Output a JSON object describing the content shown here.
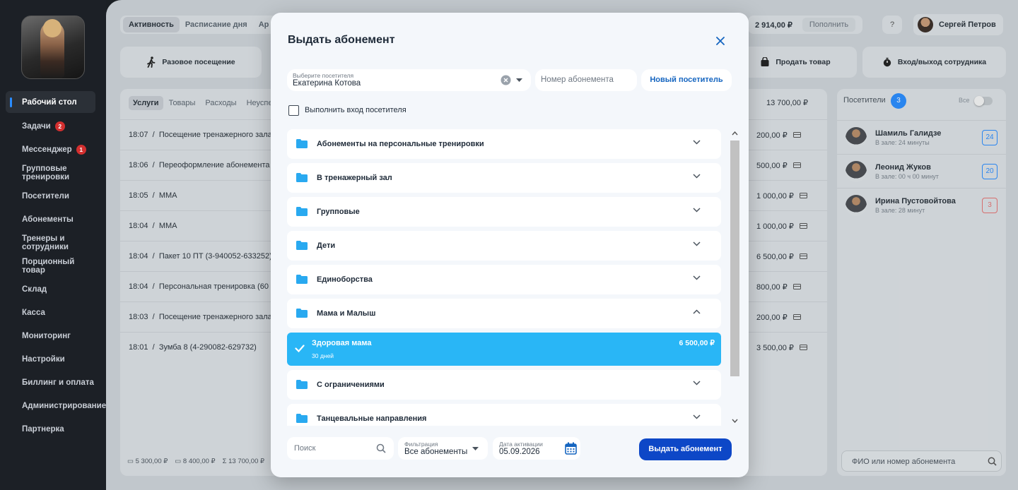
{
  "sidebar": {
    "items": [
      {
        "label": "Рабочий стол",
        "active": true
      },
      {
        "label": "Задачи",
        "badge": "2"
      },
      {
        "label": "Мессенджер",
        "badge": "1"
      },
      {
        "label": "Групповые тренировки"
      },
      {
        "label": "Посетители"
      },
      {
        "label": "Абонементы"
      },
      {
        "label": "Тренеры и сотрудники"
      },
      {
        "label": "Порционный товар"
      },
      {
        "label": "Склад"
      },
      {
        "label": "Касса"
      },
      {
        "label": "Мониторинг"
      },
      {
        "label": "Настройки"
      },
      {
        "label": "Биллинг и оплата"
      },
      {
        "label": "Администрирование"
      },
      {
        "label": "Партнерка"
      }
    ]
  },
  "topbar": {
    "tabs": [
      "Активность",
      "Расписание дня",
      "Ар"
    ],
    "balance": "2 914,00 ₽",
    "topup": "Пополнить",
    "help": "?",
    "user_name": "Сергей Петров"
  },
  "actions": {
    "single_visit": "Разовое посещение",
    "sell_product": "Продать товар",
    "staff_entry": "Вход/выход сотрудника"
  },
  "services": {
    "tabs": [
      "Услуги",
      "Товары",
      "Расходы",
      "Неуспе"
    ],
    "total": "13 700,00 ₽",
    "rows": [
      {
        "time": "18:07",
        "name": "Посещение тренажерного зала",
        "price": "200,00 ₽"
      },
      {
        "time": "18:06",
        "name": "Переоформление абонемента",
        "price": "500,00 ₽"
      },
      {
        "time": "18:05",
        "name": "ММА",
        "price": "1 000,00 ₽"
      },
      {
        "time": "18:04",
        "name": "ММА",
        "price": "1 000,00 ₽"
      },
      {
        "time": "18:04",
        "name": "Пакет 10 ПТ (3-940052-633252)",
        "price": "6 500,00 ₽"
      },
      {
        "time": "18:04",
        "name": "Персональная тренировка (60",
        "price": "800,00 ₽"
      },
      {
        "time": "18:03",
        "name": "Посещение тренажерного зала",
        "price": "200,00 ₽"
      },
      {
        "time": "18:01",
        "name": "Зумба 8 (4-290082-629732)",
        "price": "3 500,00 ₽"
      }
    ],
    "footer": {
      "cash": "5 300,00 ₽",
      "card": "8 400,00 ₽",
      "sum": "13 700,00 ₽"
    }
  },
  "visitors": {
    "title": "Посетители",
    "count": "3",
    "all_label": "Все",
    "list": [
      {
        "name": "Шамиль Галидзе",
        "status": "В зале: 24 минуты",
        "count": "24"
      },
      {
        "name": "Леонид Жуков",
        "status": "В зале: 00 ч 00 минут",
        "count": "20"
      },
      {
        "name": "Ирина Пустовойтова",
        "status": "В зале: 28 минут",
        "count": "3"
      }
    ],
    "search_placeholder": "ФИО или номер абонемента"
  },
  "modal": {
    "title": "Выдать абонемент",
    "visitor_label": "Выберите посетителя",
    "visitor_value": "Екатерина Котова",
    "subscription_number_placeholder": "Номер абонемента",
    "new_visitor": "Новый посетитель",
    "do_checkin": "Выполнить вход посетителя",
    "folders": [
      {
        "name": "Абонементы на персональные тренировки",
        "expanded": false
      },
      {
        "name": "В тренажерный зал",
        "expanded": false
      },
      {
        "name": "Групповые",
        "expanded": false
      },
      {
        "name": "Дети",
        "expanded": false
      },
      {
        "name": "Единоборства",
        "expanded": false
      },
      {
        "name": "Мама и Малыш",
        "expanded": true
      },
      {
        "name": "С ограничениями",
        "expanded": false
      },
      {
        "name": "Танцевальные направления",
        "expanded": false
      }
    ],
    "selected_item": {
      "name": "Здоровая мама",
      "duration": "30 дней",
      "price": "6 500,00 ₽"
    },
    "search_placeholder": "Поиск",
    "filter_label": "Фильтрация",
    "filter_value": "Все абонементы",
    "date_label": "Дата активации",
    "date_value": "05.09.2026",
    "submit": "Выдать абонемент"
  },
  "colors": {
    "accent": "#0d47c7",
    "selected": "#29b6f6",
    "folder": "#29a9f0"
  }
}
